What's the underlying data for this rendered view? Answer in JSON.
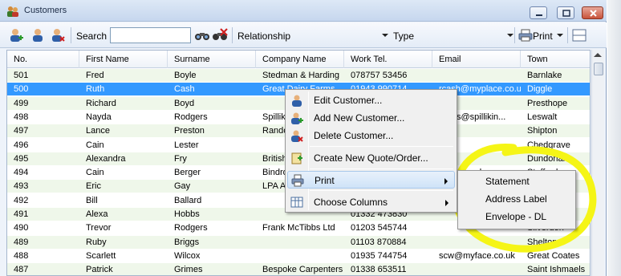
{
  "window": {
    "title": "Customers"
  },
  "toolbar": {
    "search_label": "Search",
    "search_value": "",
    "relationship_label": "Relationship",
    "type_label": "Type",
    "print_label": "Print"
  },
  "columns": [
    "No.",
    "First Name",
    "Surname",
    "Company Name",
    "Work Tel.",
    "Email",
    "Town"
  ],
  "rows": [
    [
      "501",
      "Fred",
      "Boyle",
      "Stedman & Harding",
      "078757 53456",
      "",
      "Barnlake"
    ],
    [
      "500",
      "Ruth",
      "Cash",
      "Great Dairy Farms",
      "01943 990714",
      "rcash@myplace.co.uk",
      "Diggle"
    ],
    [
      "499",
      "Richard",
      "Boyd",
      "",
      "",
      "",
      "Presthope"
    ],
    [
      "498",
      "Nayda",
      "Rodgers",
      "Spillik",
      "",
      "ngers@spillikin...",
      "Leswalt"
    ],
    [
      "497",
      "Lance",
      "Preston",
      "Rando",
      "",
      "",
      "Shipton"
    ],
    [
      "496",
      "Cain",
      "Lester",
      "",
      "",
      "",
      "Chedgrave"
    ],
    [
      "495",
      "Alexandra",
      "Fry",
      "British",
      "",
      "",
      "Dundonald"
    ],
    [
      "494",
      "Cain",
      "Berger",
      "Bindro",
      "",
      "bbble.co.uk",
      "Stafford"
    ],
    [
      "493",
      "Eric",
      "Gay",
      "LPA A",
      "",
      "",
      "Beerer"
    ],
    [
      "492",
      "Bill",
      "Ballard",
      "",
      "",
      "",
      ""
    ],
    [
      "491",
      "Alexa",
      "Hobbs",
      "",
      "01332 473830",
      "",
      ""
    ],
    [
      "490",
      "Trevor",
      "Rodgers",
      "Frank McTibbs Ltd",
      "01203 545744",
      "",
      "Silverdon"
    ],
    [
      "489",
      "Ruby",
      "Briggs",
      "",
      "01103 870884",
      "",
      "Shelton"
    ],
    [
      "488",
      "Scarlett",
      "Wilcox",
      "",
      "01935 744754",
      "scw@myface.co.uk",
      "Great Coates"
    ],
    [
      "487",
      "Patrick",
      "Grimes",
      "Bespoke Carpenters",
      "01338 653511",
      "",
      "Saint Ishmaels"
    ]
  ],
  "context_menu": {
    "edit": "Edit Customer...",
    "add": "Add New  Customer...",
    "delete": "Delete Customer...",
    "quote": "Create New Quote/Order...",
    "print": "Print",
    "columns": "Choose Columns"
  },
  "print_submenu": [
    "Statement",
    "Address Label",
    "Envelope - DL"
  ],
  "icons": {
    "title": "customers-icon",
    "add_customer": "add-user-icon",
    "edit_customer": "edit-user-icon",
    "delete_customer": "delete-user-icon",
    "find": "binoculars-icon",
    "clear_find": "binoculars-clear-icon",
    "print": "printer-icon",
    "layout": "layout-icon"
  },
  "colors": {
    "selection": "#3399ff",
    "alt_row": "#eff7ea",
    "highlight_annotation": "#f5f516"
  }
}
